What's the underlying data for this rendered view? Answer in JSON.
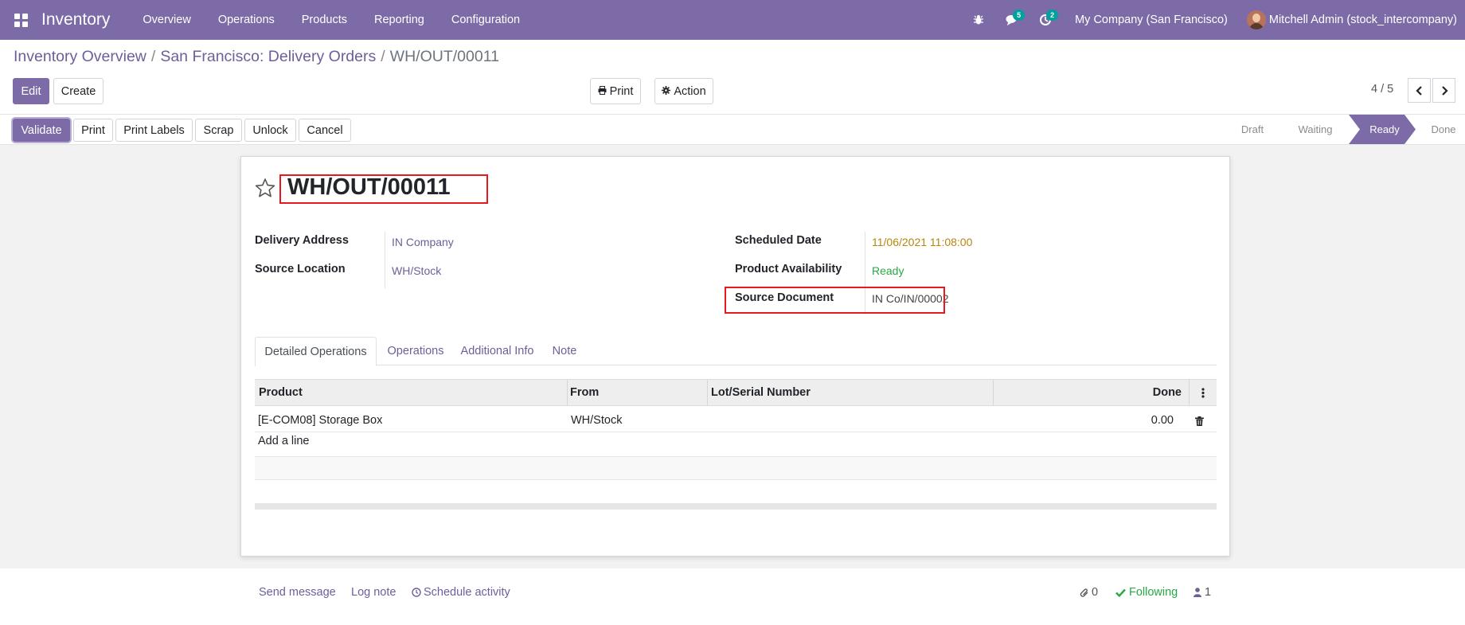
{
  "navbar": {
    "app_title": "Inventory",
    "menu": [
      "Overview",
      "Operations",
      "Products",
      "Reporting",
      "Configuration"
    ],
    "messages_count": "5",
    "activities_count": "2",
    "company": "My Company (San Francisco)",
    "user": "Mitchell Admin (stock_intercompany)",
    "icons": {
      "apps": "apps-grid-icon",
      "debug": "bug-icon",
      "messages": "chat-icon",
      "activities": "clock-icon"
    },
    "color": "#7c6ba6"
  },
  "breadcrumb": {
    "items": [
      "Inventory Overview",
      "San Francisco: Delivery Orders"
    ],
    "separator": "/",
    "current": "WH/OUT/00011"
  },
  "control": {
    "edit": "Edit",
    "create": "Create",
    "print": "Print",
    "action": "Action",
    "pager": "4 / 5"
  },
  "status_buttons": [
    "Validate",
    "Print",
    "Print Labels",
    "Scrap",
    "Unlock",
    "Cancel"
  ],
  "stages": {
    "items": [
      "Draft",
      "Waiting",
      "Ready",
      "Done"
    ],
    "active": "Ready"
  },
  "record": {
    "title": "WH/OUT/00011",
    "fields_left": [
      {
        "label": "Delivery Address",
        "value": "IN Company"
      },
      {
        "label": "Source Location",
        "value": "WH/Stock"
      }
    ],
    "fields_right": [
      {
        "label": "Scheduled Date",
        "value": "11/06/2021 11:08:00"
      },
      {
        "label": "Product Availability",
        "value": "Ready"
      },
      {
        "label": "Source Document",
        "value": "IN Co/IN/00002"
      }
    ],
    "colors": {
      "scheduled": "#b8860b",
      "ready": "#28a745",
      "link": "#6f5e99",
      "highlight": "#e8191e"
    }
  },
  "tabs": [
    "Detailed Operations",
    "Operations",
    "Additional Info",
    "Note"
  ],
  "table": {
    "headers": [
      "Product",
      "From",
      "Lot/Serial Number",
      "Done"
    ],
    "rows": [
      {
        "product": "[E-COM08] Storage Box",
        "from": "WH/Stock",
        "lot": "",
        "done": "0.00"
      }
    ],
    "add_line": "Add a line"
  },
  "chatter": {
    "send_message": "Send message",
    "log_note": "Log note",
    "schedule_activity": "Schedule activity",
    "attachments": "0",
    "following": "Following",
    "followers": "1"
  }
}
